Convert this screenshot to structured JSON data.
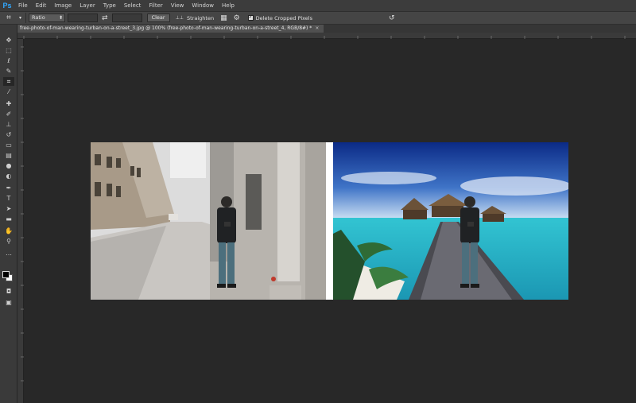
{
  "app": {
    "logo": "Ps"
  },
  "menu": [
    "File",
    "Edit",
    "Image",
    "Layer",
    "Type",
    "Select",
    "Filter",
    "View",
    "Window",
    "Help"
  ],
  "options": {
    "ratio": "Ratio",
    "clear": "Clear",
    "straighten": "Straighten",
    "delete_cropped": "Delete Cropped Pixels"
  },
  "document": {
    "tab_title": "free-photo-of-man-wearing-turban-on-a-street_3.jpg @ 100% (free-photo-of-man-wearing-turban-on-a-street_4, RGB/8#) *",
    "close": "×"
  },
  "tools": [
    {
      "name": "move-icon",
      "glyph": "✥"
    },
    {
      "name": "marquee-icon",
      "glyph": "⬚"
    },
    {
      "name": "lasso-icon",
      "glyph": "ℓ"
    },
    {
      "name": "quick-selection-icon",
      "glyph": "✎"
    },
    {
      "name": "crop-icon",
      "glyph": "⌗"
    },
    {
      "name": "eyedropper-icon",
      "glyph": "⁄"
    },
    {
      "name": "healing-brush-icon",
      "glyph": "✚"
    },
    {
      "name": "brush-icon",
      "glyph": "✐"
    },
    {
      "name": "clone-stamp-icon",
      "glyph": "⊥"
    },
    {
      "name": "history-brush-icon",
      "glyph": "↺"
    },
    {
      "name": "eraser-icon",
      "glyph": "▭"
    },
    {
      "name": "gradient-icon",
      "glyph": "▤"
    },
    {
      "name": "blur-icon",
      "glyph": "●"
    },
    {
      "name": "dodge-icon",
      "glyph": "◐"
    },
    {
      "name": "pen-icon",
      "glyph": "✒"
    },
    {
      "name": "type-icon",
      "glyph": "T"
    },
    {
      "name": "path-selection-icon",
      "glyph": "➤"
    },
    {
      "name": "rectangle-icon",
      "glyph": "▬"
    },
    {
      "name": "hand-icon",
      "glyph": "✋"
    },
    {
      "name": "zoom-icon",
      "glyph": "⚲"
    }
  ],
  "colors": {
    "foreground": "#000000",
    "background": "#ffffff",
    "accent": "#31a8ff"
  }
}
